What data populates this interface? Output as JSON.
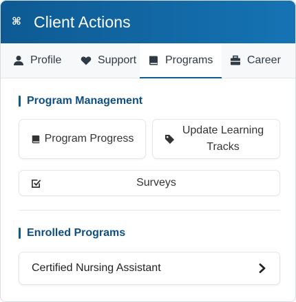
{
  "header": {
    "title": "Client Actions",
    "icon": "command-icon"
  },
  "tabs": [
    {
      "label": "Profile",
      "icon": "user-icon",
      "active": false
    },
    {
      "label": "Support",
      "icon": "heart-icon",
      "active": false
    },
    {
      "label": "Programs",
      "icon": "book-icon",
      "active": true
    },
    {
      "label": "Career",
      "icon": "briefcase-icon",
      "active": false
    }
  ],
  "program_management": {
    "title": "Program Management",
    "buttons": [
      {
        "label": "Program Progress",
        "icon": "book-icon"
      },
      {
        "label": "Update Learning Tracks",
        "icon": "tag-icon"
      },
      {
        "label": "Surveys",
        "icon": "checkbox-icon"
      }
    ]
  },
  "enrolled_programs": {
    "title": "Enrolled Programs",
    "items": [
      {
        "label": "Certified Nursing Assistant",
        "icon": "chevron-right-icon"
      }
    ]
  },
  "colors": {
    "header_start": "#0d5a93",
    "header_end": "#1673b3",
    "accent": "#0d5a93",
    "section_title": "#0d4f82"
  }
}
